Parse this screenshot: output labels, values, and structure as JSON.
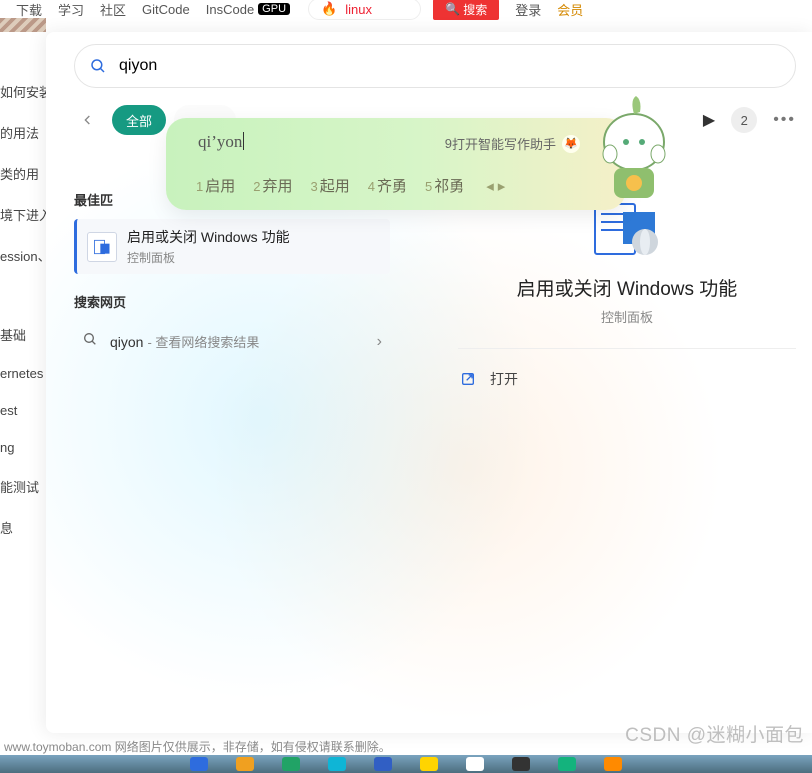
{
  "topnav": {
    "items": [
      "下载",
      "学习",
      "社区",
      "GitCode",
      "InsCode"
    ],
    "gpu_badge": "GPU",
    "pill_text": "linux",
    "search_label": "搜索",
    "login": "登录",
    "member": "会员"
  },
  "side_snippets": [
    "如何安装",
    "的用法",
    "类的用",
    "境下进入",
    "ession、",
    "基础",
    "ernetes",
    "est",
    "ng",
    "能测试",
    "息"
  ],
  "search": {
    "value": "qiyon"
  },
  "tabs": {
    "active": "全部",
    "count": "2"
  },
  "ime": {
    "pinyin": "qi’yon",
    "hint_prefix": "9 ",
    "hint": "打开智能写作助手",
    "candidates": [
      {
        "n": "1",
        "t": "启用"
      },
      {
        "n": "2",
        "t": "弃用"
      },
      {
        "n": "3",
        "t": "起用"
      },
      {
        "n": "4",
        "t": "齐勇"
      },
      {
        "n": "5",
        "t": "祁勇"
      }
    ]
  },
  "left": {
    "best_label": "最佳匹",
    "result_title": "启用或关闭 Windows 功能",
    "result_sub": "控制面板",
    "web_label": "搜索网页",
    "web_query": "qiyon",
    "web_hint": " - 查看网络搜索结果"
  },
  "detail": {
    "title": "启用或关闭 Windows 功能",
    "sub": "控制面板",
    "open": "打开"
  },
  "watermark": "CSDN @迷糊小面包",
  "footer": "www.toymoban.com 网络图片仅供展示，非存储，如有侵权请联系删除。"
}
